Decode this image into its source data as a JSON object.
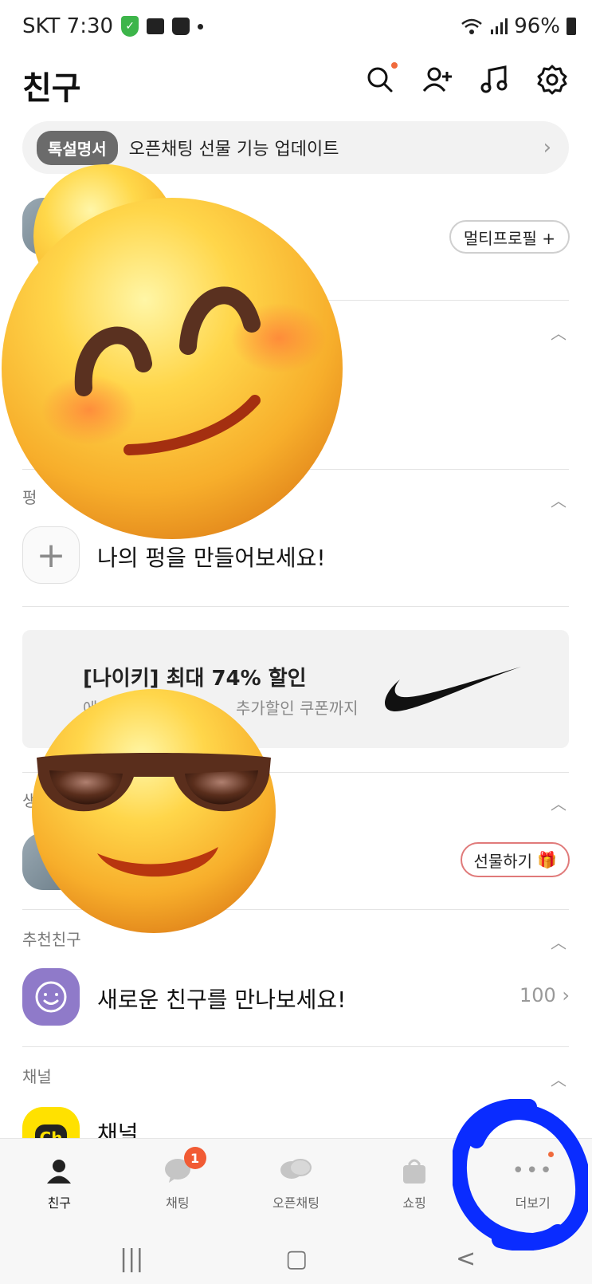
{
  "status_bar": {
    "carrier_time": "SKT 7:30",
    "battery": "96%",
    "icons": [
      "vpn-shield-icon",
      "gallery-icon",
      "shopping-bag-icon",
      "dot-icon",
      "wifi-icon",
      "signal-icon",
      "battery-icon"
    ]
  },
  "header": {
    "title": "친구",
    "icons": [
      "search-icon",
      "add-friend-icon",
      "music-icon",
      "settings-icon"
    ]
  },
  "notice": {
    "tag": "톡설명서",
    "text": "오픈채팅 선물 기능 업데이트"
  },
  "profile": {
    "multi_profile_label": "멀티프로필 +"
  },
  "pyeong": {
    "section_label": "펑",
    "cta": "나의 펑을 만들어보세요!"
  },
  "ad": {
    "title": "[나이키] 최대 74% 할인",
    "subtitle_left": "에",
    "subtitle_right": "추가할인 쿠폰까지"
  },
  "birthday": {
    "section_label": "생",
    "gift_label": "선물하기"
  },
  "recommend": {
    "section_label": "추천친구",
    "cta": "새로운 친구를 만나보세요!",
    "count": "100"
  },
  "channel": {
    "section_label": "채널",
    "item_label": "채널",
    "logo_text": "Ch"
  },
  "bottom_nav": {
    "tabs": [
      {
        "label": "친구",
        "icon": "person-icon"
      },
      {
        "label": "채팅",
        "icon": "chat-icon",
        "badge": "1"
      },
      {
        "label": "오픈채팅",
        "icon": "open-chat-icon"
      },
      {
        "label": "쇼핑",
        "icon": "shopping-icon"
      },
      {
        "label": "더보기",
        "icon": "more-icon"
      }
    ]
  },
  "system_nav": {
    "recents": "|||",
    "home": "▢",
    "back": "<"
  },
  "colors": {
    "accent_orange": "#f06a3c",
    "badge_red": "#f15b34",
    "friend_purple": "#8f7ac9",
    "channel_yellow": "#ffe100",
    "scribble_blue": "#0a2cff"
  }
}
